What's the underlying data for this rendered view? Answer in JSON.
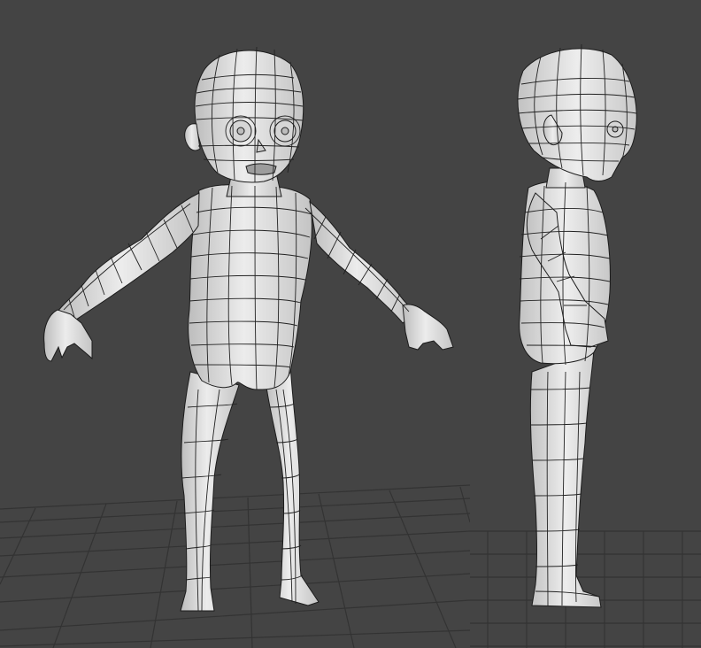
{
  "app": {
    "viewport_count": 2
  },
  "viewports": [
    {
      "name": "front",
      "label": ""
    },
    {
      "name": "side",
      "label": ""
    }
  ],
  "scene": {
    "object": "low-poly-character-base-mesh",
    "shading": "wireframe-on-shaded",
    "colors": {
      "background": "#444444",
      "grid": "#333333",
      "mesh_fill": "#e2e2e2",
      "mesh_shadow": "#b9b9b9",
      "wire": "#1c1c1c"
    }
  }
}
